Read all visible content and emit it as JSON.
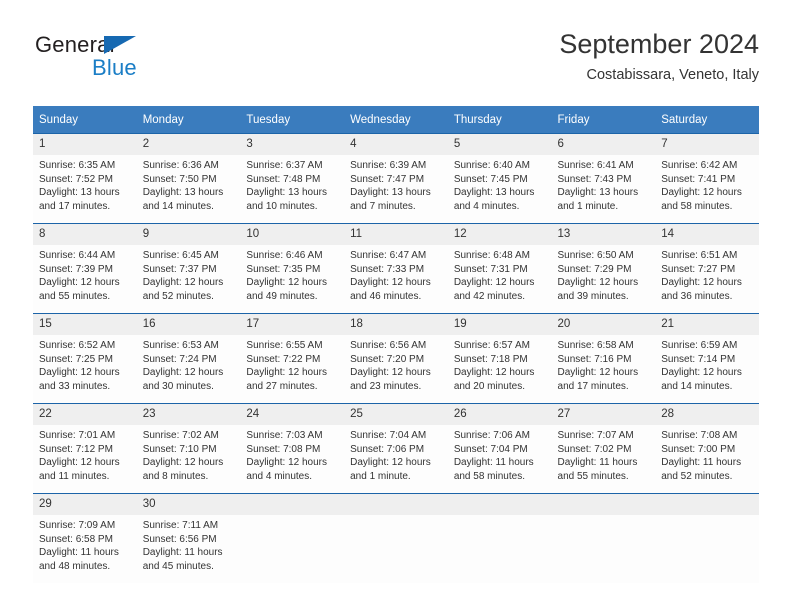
{
  "brand": {
    "name_part1": "General",
    "name_part2": "Blue",
    "logo_icon": "blue-triangle-icon"
  },
  "header": {
    "title": "September 2024",
    "subtitle": "Costabissara, Veneto, Italy"
  },
  "colors": {
    "header_blue": "#3a7cbe",
    "grid_line_blue": "#1c64a8",
    "daynum_background": "#efefef",
    "brand_blue": "#1b7ec6",
    "text": "#333333"
  },
  "calendar": {
    "weekday_headers": [
      "Sunday",
      "Monday",
      "Tuesday",
      "Wednesday",
      "Thursday",
      "Friday",
      "Saturday"
    ],
    "weeks": [
      [
        {
          "day": "1",
          "sunrise": "Sunrise: 6:35 AM",
          "sunset": "Sunset: 7:52 PM",
          "daylight_line1": "Daylight: 13 hours",
          "daylight_line2": "and 17 minutes."
        },
        {
          "day": "2",
          "sunrise": "Sunrise: 6:36 AM",
          "sunset": "Sunset: 7:50 PM",
          "daylight_line1": "Daylight: 13 hours",
          "daylight_line2": "and 14 minutes."
        },
        {
          "day": "3",
          "sunrise": "Sunrise: 6:37 AM",
          "sunset": "Sunset: 7:48 PM",
          "daylight_line1": "Daylight: 13 hours",
          "daylight_line2": "and 10 minutes."
        },
        {
          "day": "4",
          "sunrise": "Sunrise: 6:39 AM",
          "sunset": "Sunset: 7:47 PM",
          "daylight_line1": "Daylight: 13 hours",
          "daylight_line2": "and 7 minutes."
        },
        {
          "day": "5",
          "sunrise": "Sunrise: 6:40 AM",
          "sunset": "Sunset: 7:45 PM",
          "daylight_line1": "Daylight: 13 hours",
          "daylight_line2": "and 4 minutes."
        },
        {
          "day": "6",
          "sunrise": "Sunrise: 6:41 AM",
          "sunset": "Sunset: 7:43 PM",
          "daylight_line1": "Daylight: 13 hours",
          "daylight_line2": "and 1 minute."
        },
        {
          "day": "7",
          "sunrise": "Sunrise: 6:42 AM",
          "sunset": "Sunset: 7:41 PM",
          "daylight_line1": "Daylight: 12 hours",
          "daylight_line2": "and 58 minutes."
        }
      ],
      [
        {
          "day": "8",
          "sunrise": "Sunrise: 6:44 AM",
          "sunset": "Sunset: 7:39 PM",
          "daylight_line1": "Daylight: 12 hours",
          "daylight_line2": "and 55 minutes."
        },
        {
          "day": "9",
          "sunrise": "Sunrise: 6:45 AM",
          "sunset": "Sunset: 7:37 PM",
          "daylight_line1": "Daylight: 12 hours",
          "daylight_line2": "and 52 minutes."
        },
        {
          "day": "10",
          "sunrise": "Sunrise: 6:46 AM",
          "sunset": "Sunset: 7:35 PM",
          "daylight_line1": "Daylight: 12 hours",
          "daylight_line2": "and 49 minutes."
        },
        {
          "day": "11",
          "sunrise": "Sunrise: 6:47 AM",
          "sunset": "Sunset: 7:33 PM",
          "daylight_line1": "Daylight: 12 hours",
          "daylight_line2": "and 46 minutes."
        },
        {
          "day": "12",
          "sunrise": "Sunrise: 6:48 AM",
          "sunset": "Sunset: 7:31 PM",
          "daylight_line1": "Daylight: 12 hours",
          "daylight_line2": "and 42 minutes."
        },
        {
          "day": "13",
          "sunrise": "Sunrise: 6:50 AM",
          "sunset": "Sunset: 7:29 PM",
          "daylight_line1": "Daylight: 12 hours",
          "daylight_line2": "and 39 minutes."
        },
        {
          "day": "14",
          "sunrise": "Sunrise: 6:51 AM",
          "sunset": "Sunset: 7:27 PM",
          "daylight_line1": "Daylight: 12 hours",
          "daylight_line2": "and 36 minutes."
        }
      ],
      [
        {
          "day": "15",
          "sunrise": "Sunrise: 6:52 AM",
          "sunset": "Sunset: 7:25 PM",
          "daylight_line1": "Daylight: 12 hours",
          "daylight_line2": "and 33 minutes."
        },
        {
          "day": "16",
          "sunrise": "Sunrise: 6:53 AM",
          "sunset": "Sunset: 7:24 PM",
          "daylight_line1": "Daylight: 12 hours",
          "daylight_line2": "and 30 minutes."
        },
        {
          "day": "17",
          "sunrise": "Sunrise: 6:55 AM",
          "sunset": "Sunset: 7:22 PM",
          "daylight_line1": "Daylight: 12 hours",
          "daylight_line2": "and 27 minutes."
        },
        {
          "day": "18",
          "sunrise": "Sunrise: 6:56 AM",
          "sunset": "Sunset: 7:20 PM",
          "daylight_line1": "Daylight: 12 hours",
          "daylight_line2": "and 23 minutes."
        },
        {
          "day": "19",
          "sunrise": "Sunrise: 6:57 AM",
          "sunset": "Sunset: 7:18 PM",
          "daylight_line1": "Daylight: 12 hours",
          "daylight_line2": "and 20 minutes."
        },
        {
          "day": "20",
          "sunrise": "Sunrise: 6:58 AM",
          "sunset": "Sunset: 7:16 PM",
          "daylight_line1": "Daylight: 12 hours",
          "daylight_line2": "and 17 minutes."
        },
        {
          "day": "21",
          "sunrise": "Sunrise: 6:59 AM",
          "sunset": "Sunset: 7:14 PM",
          "daylight_line1": "Daylight: 12 hours",
          "daylight_line2": "and 14 minutes."
        }
      ],
      [
        {
          "day": "22",
          "sunrise": "Sunrise: 7:01 AM",
          "sunset": "Sunset: 7:12 PM",
          "daylight_line1": "Daylight: 12 hours",
          "daylight_line2": "and 11 minutes."
        },
        {
          "day": "23",
          "sunrise": "Sunrise: 7:02 AM",
          "sunset": "Sunset: 7:10 PM",
          "daylight_line1": "Daylight: 12 hours",
          "daylight_line2": "and 8 minutes."
        },
        {
          "day": "24",
          "sunrise": "Sunrise: 7:03 AM",
          "sunset": "Sunset: 7:08 PM",
          "daylight_line1": "Daylight: 12 hours",
          "daylight_line2": "and 4 minutes."
        },
        {
          "day": "25",
          "sunrise": "Sunrise: 7:04 AM",
          "sunset": "Sunset: 7:06 PM",
          "daylight_line1": "Daylight: 12 hours",
          "daylight_line2": "and 1 minute."
        },
        {
          "day": "26",
          "sunrise": "Sunrise: 7:06 AM",
          "sunset": "Sunset: 7:04 PM",
          "daylight_line1": "Daylight: 11 hours",
          "daylight_line2": "and 58 minutes."
        },
        {
          "day": "27",
          "sunrise": "Sunrise: 7:07 AM",
          "sunset": "Sunset: 7:02 PM",
          "daylight_line1": "Daylight: 11 hours",
          "daylight_line2": "and 55 minutes."
        },
        {
          "day": "28",
          "sunrise": "Sunrise: 7:08 AM",
          "sunset": "Sunset: 7:00 PM",
          "daylight_line1": "Daylight: 11 hours",
          "daylight_line2": "and 52 minutes."
        }
      ],
      [
        {
          "day": "29",
          "sunrise": "Sunrise: 7:09 AM",
          "sunset": "Sunset: 6:58 PM",
          "daylight_line1": "Daylight: 11 hours",
          "daylight_line2": "and 48 minutes."
        },
        {
          "day": "30",
          "sunrise": "Sunrise: 7:11 AM",
          "sunset": "Sunset: 6:56 PM",
          "daylight_line1": "Daylight: 11 hours",
          "daylight_line2": "and 45 minutes."
        },
        {
          "day": "",
          "sunrise": "",
          "sunset": "",
          "daylight_line1": "",
          "daylight_line2": ""
        },
        {
          "day": "",
          "sunrise": "",
          "sunset": "",
          "daylight_line1": "",
          "daylight_line2": ""
        },
        {
          "day": "",
          "sunrise": "",
          "sunset": "",
          "daylight_line1": "",
          "daylight_line2": ""
        },
        {
          "day": "",
          "sunrise": "",
          "sunset": "",
          "daylight_line1": "",
          "daylight_line2": ""
        },
        {
          "day": "",
          "sunrise": "",
          "sunset": "",
          "daylight_line1": "",
          "daylight_line2": ""
        }
      ]
    ]
  }
}
